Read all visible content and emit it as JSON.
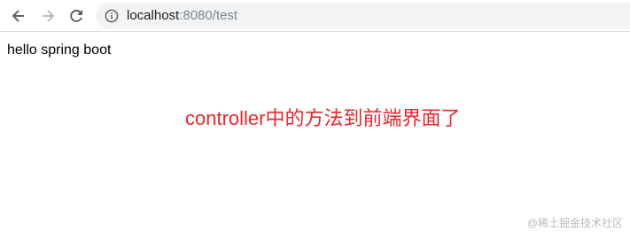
{
  "browser": {
    "url_host": "localhost",
    "url_port_path": ":8080/test",
    "back_icon": "arrow-left-icon",
    "forward_icon": "arrow-right-icon",
    "reload_icon": "reload-icon",
    "site_info_icon": "info-circle-icon"
  },
  "page": {
    "body_text": "hello spring boot"
  },
  "annotation": {
    "text": "controller中的方法到前端界面了",
    "color": "#e8262d"
  },
  "watermark": {
    "text": "@稀土掘金技术社区"
  }
}
